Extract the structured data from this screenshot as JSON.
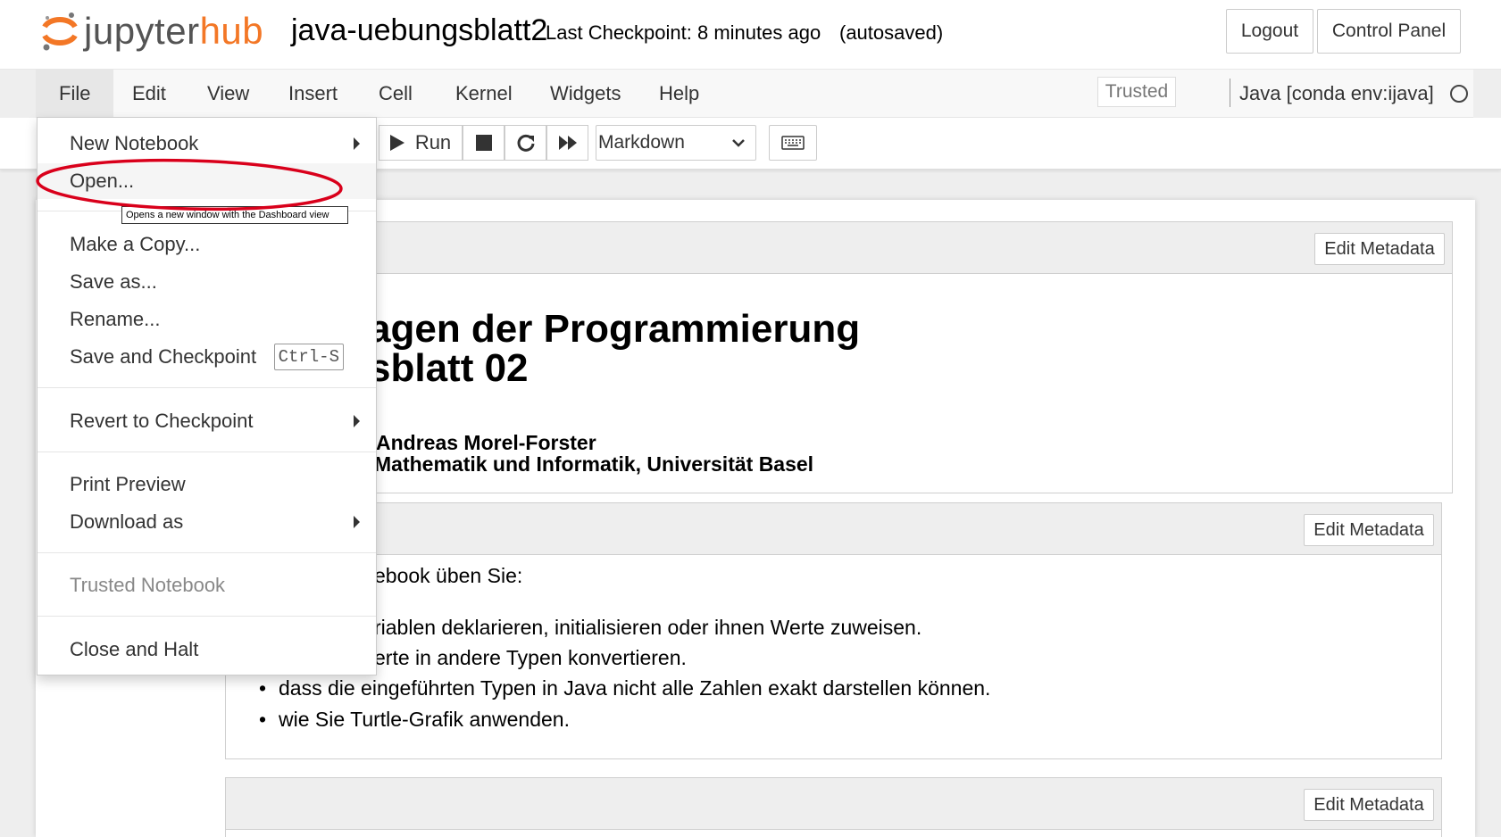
{
  "header": {
    "logo_left": "jupyter",
    "logo_right": "hub",
    "notebook_name": "java-uebungsblatt2",
    "checkpoint": "Last Checkpoint: 8 minutes ago",
    "autosaved": "(autosaved)",
    "logout_label": "Logout",
    "control_panel_label": "Control Panel"
  },
  "menubar": {
    "items": [
      "File",
      "Edit",
      "View",
      "Insert",
      "Cell",
      "Kernel",
      "Widgets",
      "Help"
    ],
    "trusted": "Trusted",
    "kernel": "Java [conda env:ijava]"
  },
  "toolbar": {
    "run_label": "Run",
    "cell_type": "Markdown"
  },
  "file_menu": {
    "items": [
      {
        "label": "New Notebook",
        "submenu": true
      },
      {
        "label": "Open...",
        "hover": true
      },
      {
        "label": "Make a Copy..."
      },
      {
        "label": "Save as..."
      },
      {
        "label": "Rename..."
      },
      {
        "label": "Save and Checkpoint",
        "shortcut": "Ctrl-S"
      },
      {
        "label": "Revert to Checkpoint",
        "submenu": true
      },
      {
        "label": "Print Preview"
      },
      {
        "label": "Download as",
        "submenu": true
      },
      {
        "label": "Trusted Notebook",
        "disabled": true
      },
      {
        "label": "Close and Halt"
      }
    ],
    "tooltip": "Opens a new window with the Dashboard view"
  },
  "cells": {
    "edit_metadata": "Edit Metadata",
    "cell1": {
      "title_line1": "agen der Programmierung",
      "title_line2": "sblatt 02",
      "author_line1": "Andreas Morel-Forster",
      "author_line2": "Mathematik und Informatik, Universität Basel"
    },
    "cell2": {
      "intro": "ebook üben Sie:",
      "bullets": [
        "riablen deklarieren, initialisieren oder ihnen Werte zuweisen.",
        "erte in andere Typen konvertieren.",
        "dass die eingeführten Typen in Java nicht alle Zahlen exakt darstellen können.",
        "wie Sie Turtle-Grafik anwenden."
      ]
    }
  },
  "colors": {
    "logo_orange": "#f37726",
    "annotation_red": "#d9001b"
  }
}
